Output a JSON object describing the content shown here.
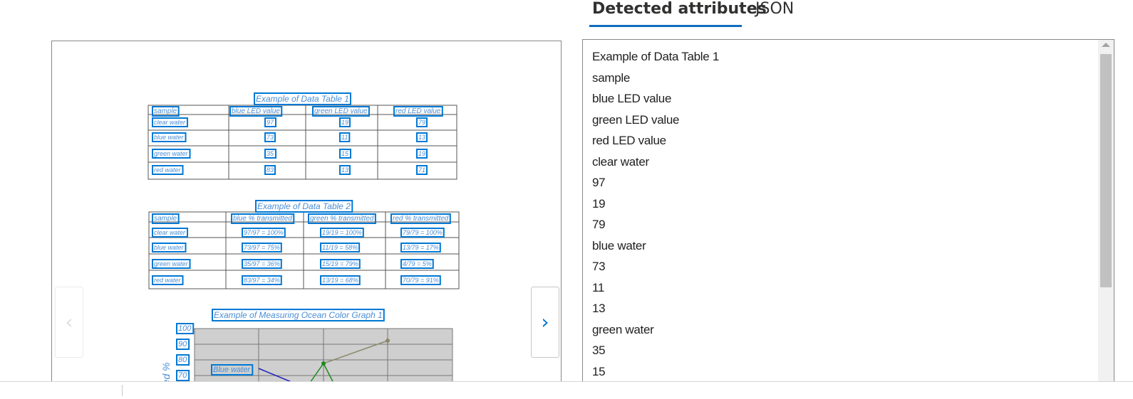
{
  "tabs": {
    "detected": "Detected attributes",
    "json": "JSON"
  },
  "preview": {
    "table1": {
      "title": "Example of Data Table 1",
      "headers": [
        "sample",
        "blue LED value",
        "green LED value",
        "red LED value"
      ],
      "rows": [
        [
          "clear water",
          "97",
          "19",
          "79"
        ],
        [
          "blue water",
          "73",
          "11",
          "13"
        ],
        [
          "green water",
          "35",
          "15",
          "19"
        ],
        [
          "red water",
          "83",
          "13",
          "71"
        ]
      ]
    },
    "table2": {
      "title": "Example of Data Table 2",
      "headers": [
        "sample",
        "blue % transmitted",
        "green % transmitted",
        "red % transmitted"
      ],
      "rows": [
        [
          "clear water",
          "97/97 = 100%",
          "19/19 = 100%",
          "79/79 = 100%"
        ],
        [
          "blue water",
          "73/97 = 75%",
          "11/19 = 58%",
          "13/79 = 17%"
        ],
        [
          "green water",
          "35/97 = 36%",
          "15/19 = 79%",
          "4/79 = 5%"
        ],
        [
          "red water",
          "83/97 = 34%",
          "13/19 = 68%",
          "70/79 = 91%"
        ]
      ]
    },
    "graph": {
      "title": "Example of Measuring Ocean Color Graph 1",
      "y_ticks": [
        "100",
        "90",
        "80",
        "70"
      ],
      "ylabel": "red %",
      "series_label": "Blue water"
    },
    "prev_icon": "chevron-left-icon",
    "next_icon": "chevron-right-icon",
    "prev_glyph": "‹",
    "next_glyph": "›"
  },
  "attributes": [
    "Example of Data Table 1",
    "sample",
    "blue LED value",
    "green LED value",
    "red LED value",
    "clear water",
    "97",
    "19",
    "79",
    "blue water",
    "73",
    "11",
    "13",
    "green water",
    "35",
    "15"
  ],
  "colors": {
    "accent": "#0f6cbd",
    "ocr_box": "#0078d4",
    "ocr_text": "#4a8ed6"
  }
}
